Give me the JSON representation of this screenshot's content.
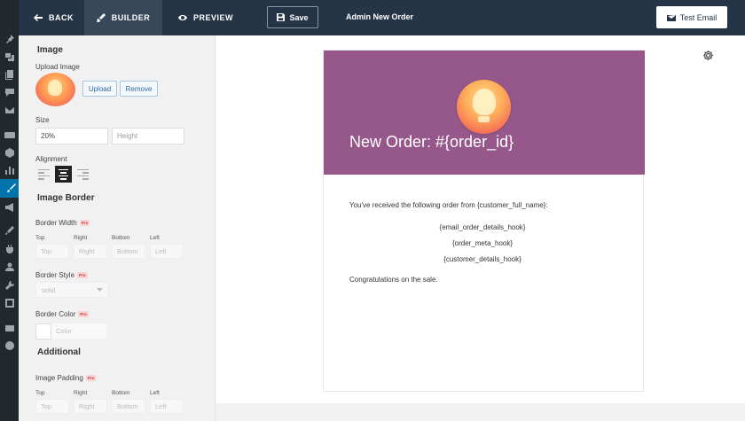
{
  "topbar": {
    "back_label": "BACK",
    "builder_label": "BUILDER",
    "preview_label": "PREVIEW",
    "save_label": "Save",
    "page_name": "Admin New Order",
    "test_email_label": "Test Email"
  },
  "panel": {
    "image_section": "Image",
    "upload_image_label": "Upload Image",
    "upload_button": "Upload",
    "remove_button": "Remove",
    "size_label": "Size",
    "width_value": "20%",
    "height_placeholder": "Height",
    "alignment_label": "Alignment",
    "border_section": "Image Border",
    "border_width_label": "Border Width",
    "pro_badge": "Pro",
    "side_labels": [
      "Top",
      "Right",
      "Bottom",
      "Left"
    ],
    "border_style_label": "Border Style",
    "border_style_value": "solid",
    "border_color_label": "Border Color",
    "color_placeholder": "Color",
    "additional_section": "Additional",
    "image_padding_label": "Image Padding"
  },
  "email": {
    "title": "New Order: #{order_id}",
    "intro": "You've received the following order from {customer_full_name}:",
    "hook1": "{email_order_details_hook}",
    "hook2": "{order_meta_hook}",
    "hook3": "{customer_details_hook}",
    "closing": "Congratulations on the sale."
  },
  "colors": {
    "topbar": "#253447",
    "header": "#96588a",
    "active_rail": "#0073aa"
  }
}
